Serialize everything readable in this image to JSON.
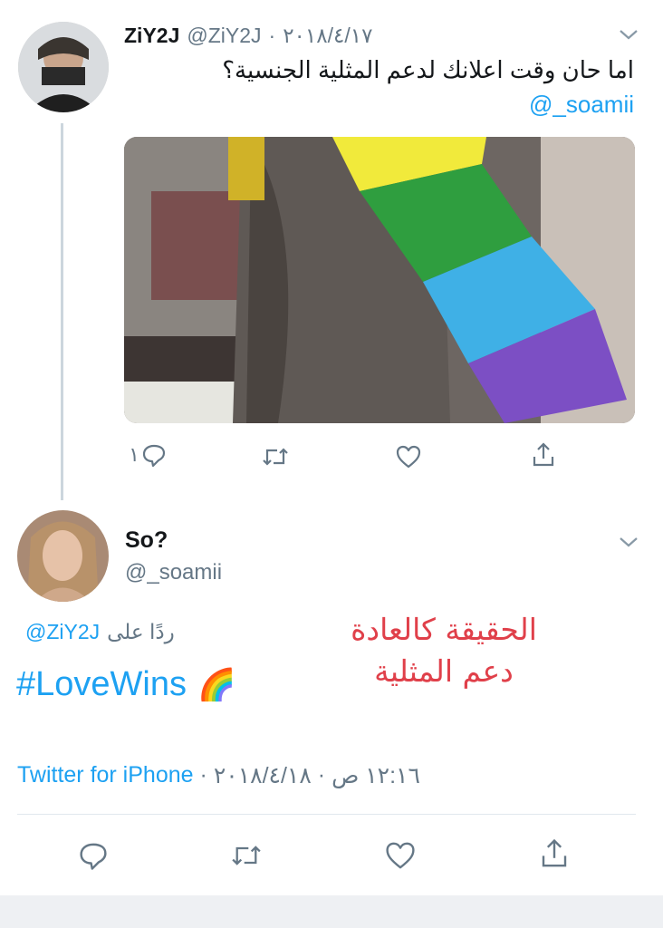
{
  "colors": {
    "link": "#1da1f2",
    "muted": "#657786",
    "annotation": "#e0404a",
    "line": "#ccd6dd"
  },
  "parent_tweet": {
    "display_name": "ZiY2J",
    "handle": "@ZiY2J",
    "separator": "·",
    "date": "٢٠١٨/٤/١٧",
    "text": "اما حان وقت اعلانك لدعم المثلية الجنسية؟",
    "mention": "@_soamii",
    "actions": {
      "reply_count": "١",
      "icons": [
        "reply-icon",
        "retweet-icon",
        "like-icon",
        "share-icon"
      ]
    }
  },
  "reply_tweet": {
    "display_name": "So?",
    "handle": "@_soamii",
    "replying_to_label": "ردًا على",
    "replying_to_handle": "@ZiY2J",
    "hashtag": "#LoveWins",
    "emoji": "🌈",
    "source": "Twitter for iPhone",
    "meta_sep": "·",
    "meta_date": "٢٠١٨/٤/١٨",
    "meta_time": "١٢:١٦ ص",
    "actions": {
      "icons": [
        "reply-icon",
        "retweet-icon",
        "like-icon",
        "share-icon"
      ]
    }
  },
  "annotation": {
    "line1": "الحقيقة كالعادة",
    "line2": "دعم المثلية"
  }
}
